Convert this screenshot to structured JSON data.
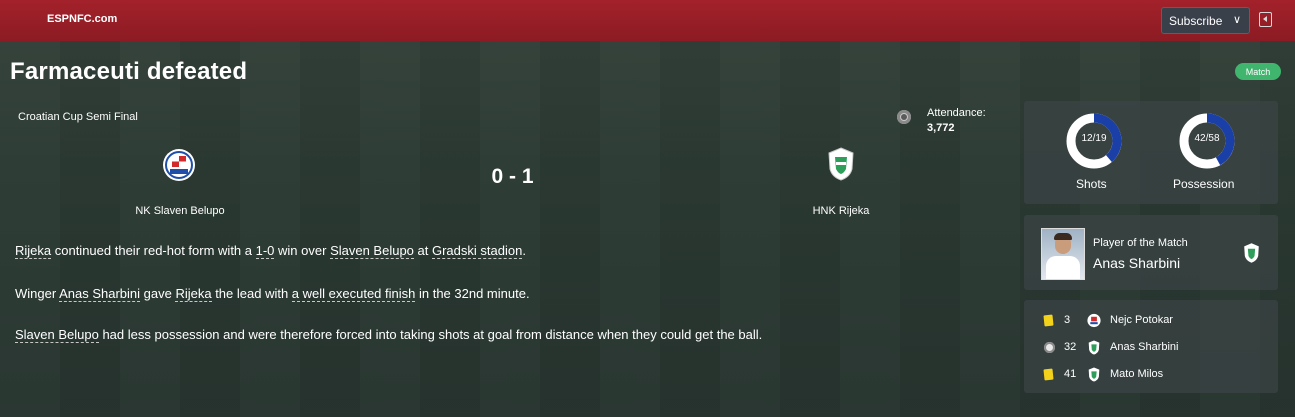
{
  "header": {
    "brand": "ESPNFC.com",
    "subscribe_label": "Subscribe",
    "collapse_icon": "collapse-panel-icon"
  },
  "article": {
    "title": "Farmaceuti defeated",
    "badge": "Match",
    "competition": "Croatian Cup Semi Final",
    "attendance_label": "Attendance:",
    "attendance_value": "3,772"
  },
  "match": {
    "home_team": "NK Slaven Belupo",
    "away_team": "HNK Rijeka",
    "score": "0 - 1",
    "colors": {
      "home_crest": "#1f4fa8",
      "away_crest": "#2e9e5a"
    }
  },
  "report": {
    "p1": {
      "w1": "Rijeka",
      "t1": " continued their red-hot form with a ",
      "w2": "1-0",
      "t2": " win over ",
      "w3": "Slaven Belupo",
      "t3": " at ",
      "w4": "Gradski stadion",
      "t4": "."
    },
    "p2": {
      "t0": "Winger ",
      "w1": "Anas Sharbini",
      "t1": " gave ",
      "w2": "Rijeka",
      "t2": " the lead with ",
      "w3": "a well executed finish",
      "t3": " in the 32nd minute."
    },
    "p3": {
      "w1": "Slaven Belupo",
      "t1": " had less possession and were therefore forced into taking shots at goal from distance when they could get the ball."
    }
  },
  "stats": {
    "shots": {
      "label": "Shots",
      "value_text": "12/19",
      "home": 12,
      "away": 19
    },
    "possession": {
      "label": "Possession",
      "value_text": "42/58",
      "home": 42,
      "away": 58
    },
    "colors": {
      "home": "#1a3fa6",
      "away": "#ffffff"
    }
  },
  "potm": {
    "label": "Player of the Match",
    "name": "Anas Sharbini"
  },
  "events": [
    {
      "icon": "yellow-card-icon",
      "minute": "3",
      "team": "home",
      "player": "Nejc Potokar"
    },
    {
      "icon": "goal-ball-icon",
      "minute": "32",
      "team": "away",
      "player": "Anas Sharbini"
    },
    {
      "icon": "yellow-card-icon",
      "minute": "41",
      "team": "away",
      "player": "Mato Milos"
    }
  ]
}
